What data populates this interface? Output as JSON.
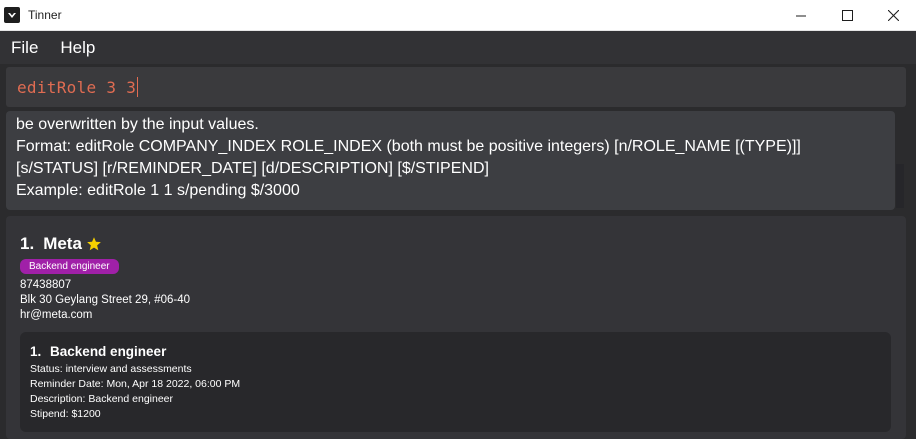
{
  "window": {
    "title": "Tinner"
  },
  "menu": {
    "file": "File",
    "help": "Help"
  },
  "command": {
    "value": "editRole 3 3"
  },
  "result": {
    "lines": [
      "be overwritten by the input values.",
      "Format: editRole COMPANY_INDEX ROLE_INDEX (both must be positive integers) [n/ROLE_NAME [(TYPE)]]",
      "[s/STATUS] [r/REMINDER_DATE] [d/DESCRIPTION] [$/STIPEND]",
      "Example: editRole 1 1 s/pending $/3000"
    ]
  },
  "company": {
    "index": "1.",
    "name": "Meta",
    "favourite": true,
    "tag": "Backend engineer",
    "phone": "87438807",
    "address": "Blk 30 Geylang Street 29, #06-40",
    "email": "hr@meta.com",
    "roles": [
      {
        "index": "1.",
        "name": "Backend engineer",
        "status": "Status: interview and assessments",
        "reminder": "Reminder Date: Mon, Apr 18 2022, 06:00 PM",
        "description": "Description: Backend engineer",
        "stipend": "Stipend: $1200"
      }
    ]
  },
  "colors": {
    "background": "#2b2b2d",
    "command_text": "#e06c52",
    "tag": "#a020a8",
    "star": "#f5d000"
  }
}
